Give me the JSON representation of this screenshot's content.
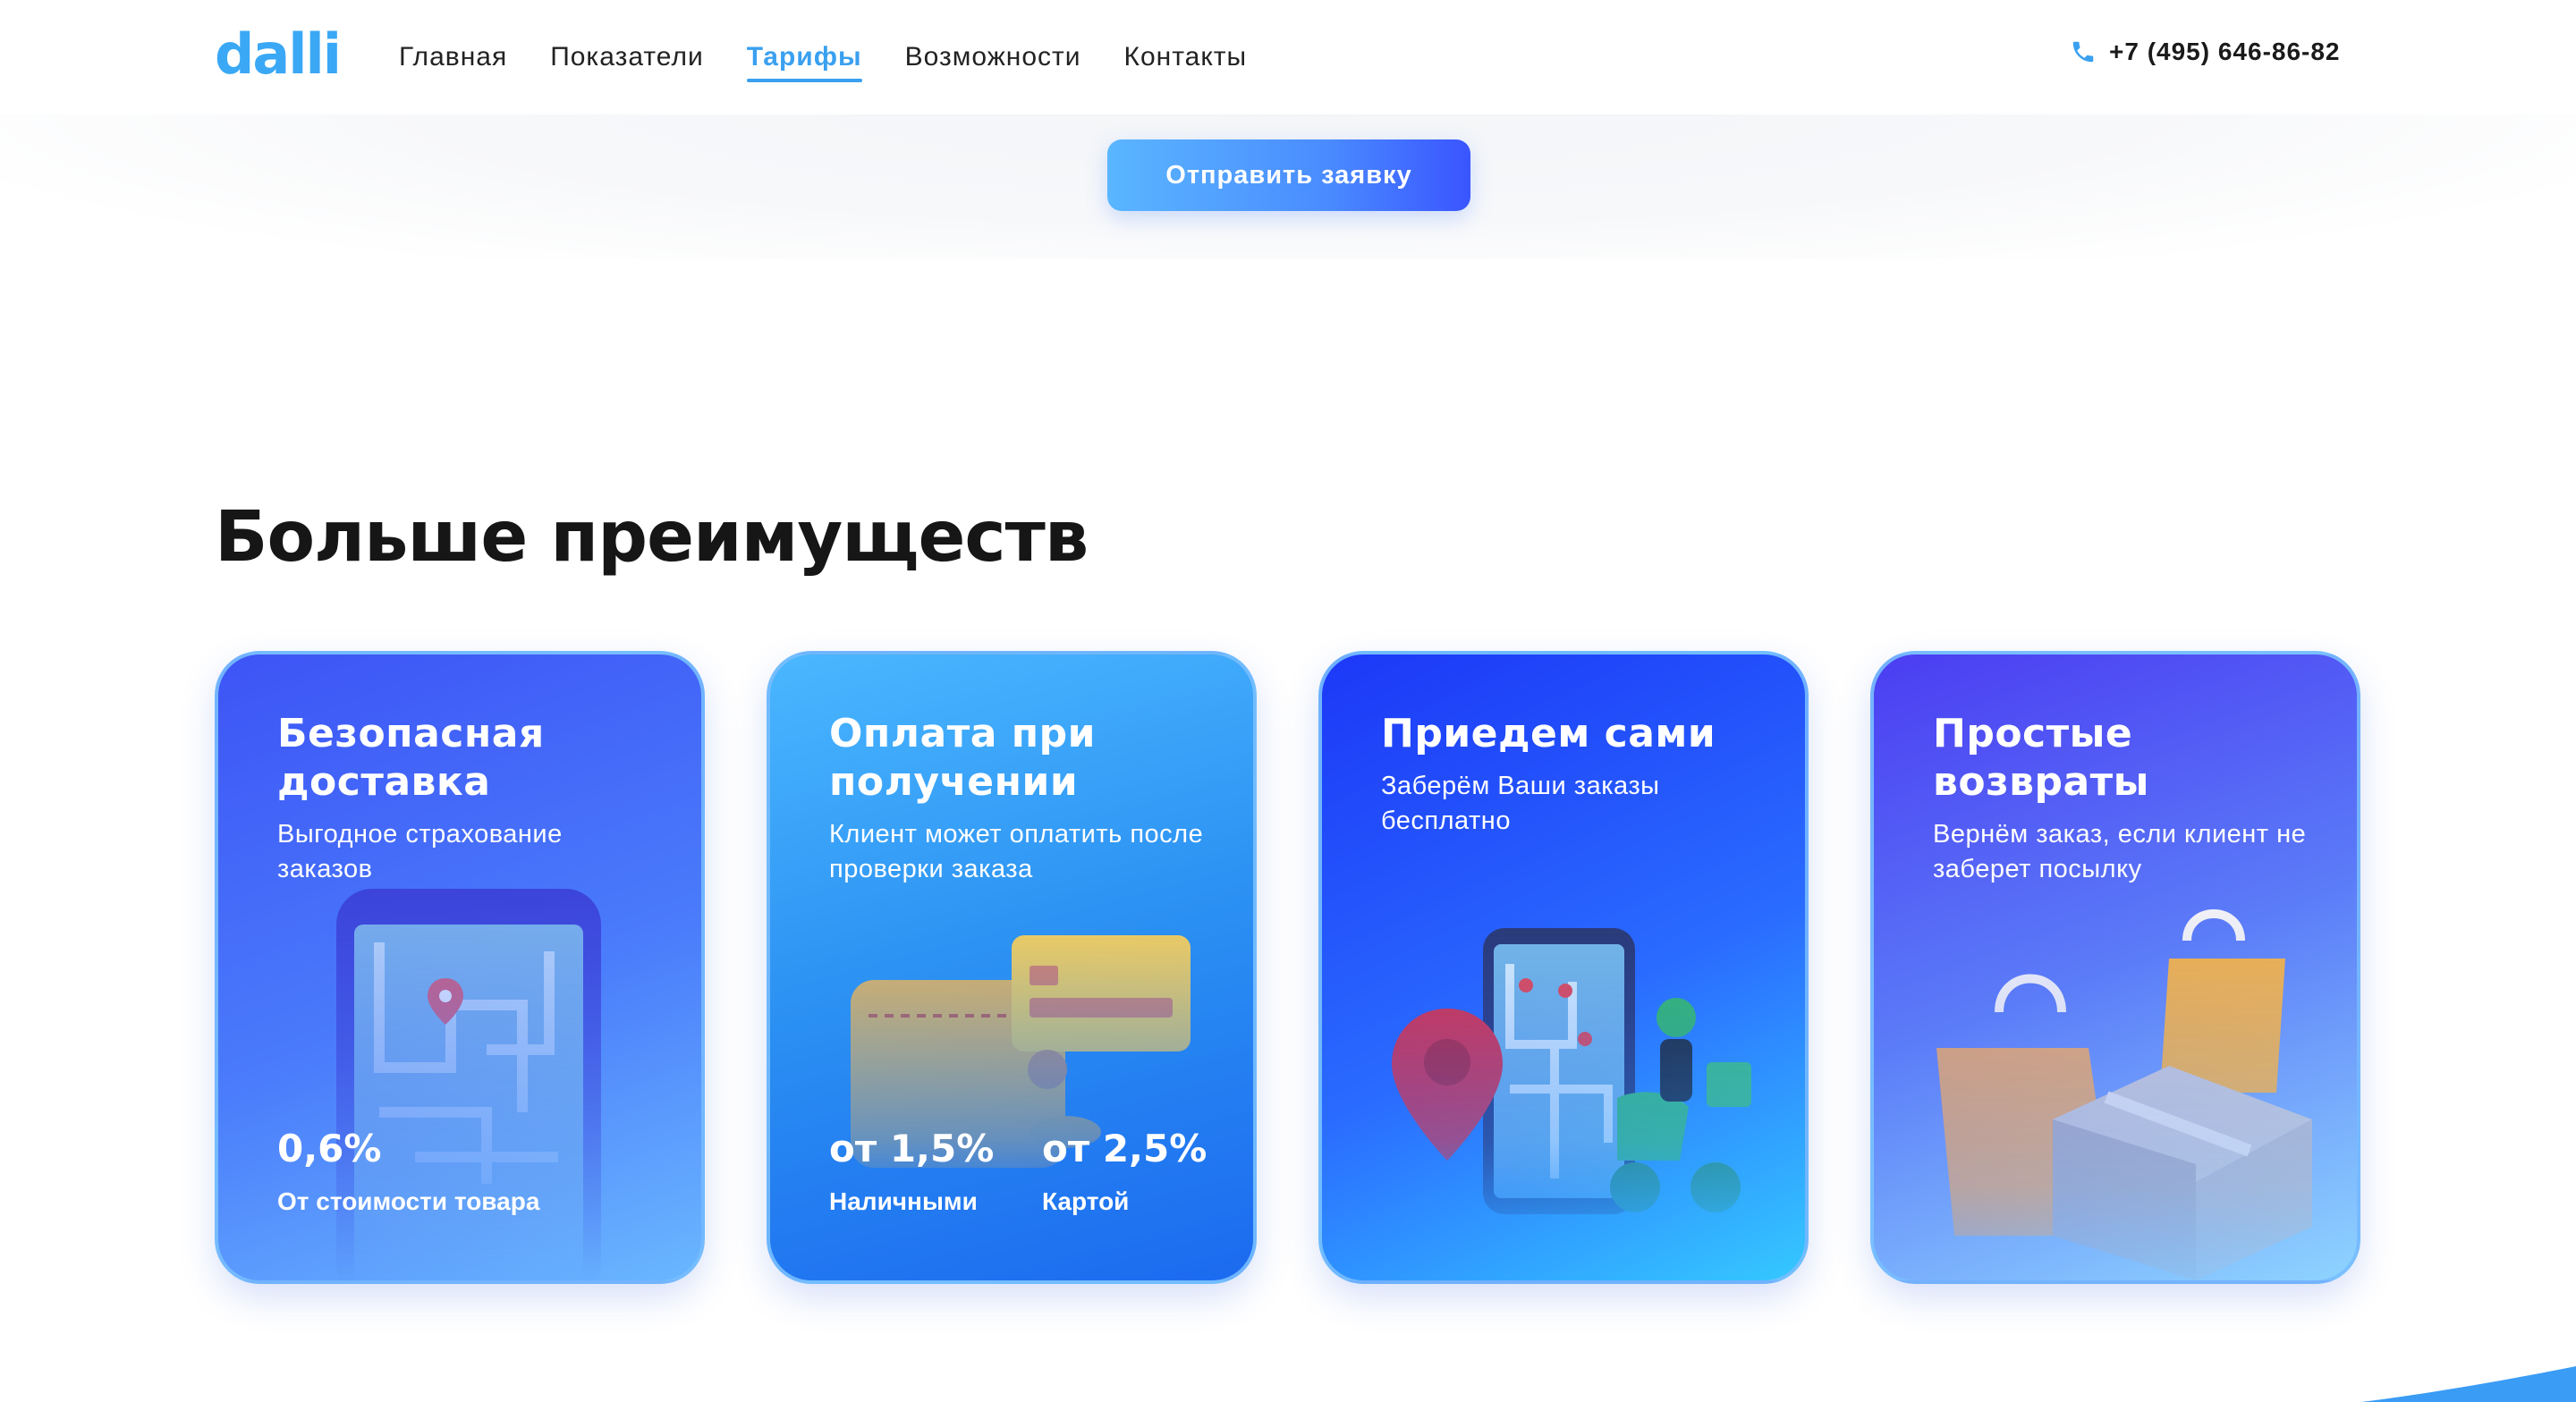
{
  "header": {
    "logo": "dalli",
    "nav": [
      {
        "label": "Главная",
        "active": false
      },
      {
        "label": "Показатели",
        "active": false
      },
      {
        "label": "Тарифы",
        "active": true
      },
      {
        "label": "Возможности",
        "active": false
      },
      {
        "label": "Контакты",
        "active": false
      }
    ],
    "phone": "+7 (495) 646-86-82",
    "phone_icon": "phone-icon"
  },
  "cta": {
    "label": "Отправить заявку"
  },
  "section": {
    "title": "Больше преимуществ"
  },
  "cards": [
    {
      "title": "Безопасная доставка",
      "description": "Выгодное страхование заказов",
      "stats": [
        {
          "value": "0,6%",
          "caption": "От стоимости товара"
        }
      ],
      "illustration": "phone-map-illustration"
    },
    {
      "title": "Оплата при получении",
      "description": "Клиент может оплатить после проверки заказа",
      "stats": [
        {
          "value": "от 1,5%",
          "caption": "Наличными"
        },
        {
          "value": "от 2,5%",
          "caption": "Картой"
        }
      ],
      "illustration": "wallet-card-illustration"
    },
    {
      "title": "Приедем сами",
      "description": "Заберём Ваши заказы бесплатно",
      "stats": [],
      "illustration": "courier-scooter-illustration"
    },
    {
      "title": "Простые возвраты",
      "description": "Вернём заказ, если клиент не заберет посылку",
      "stats": [],
      "illustration": "bags-box-illustration"
    }
  ],
  "colors": {
    "accent": "#3aa0f0",
    "logo": "#3aa8f5",
    "cta_start": "#5ab6ff",
    "cta_end": "#3a55ff"
  }
}
